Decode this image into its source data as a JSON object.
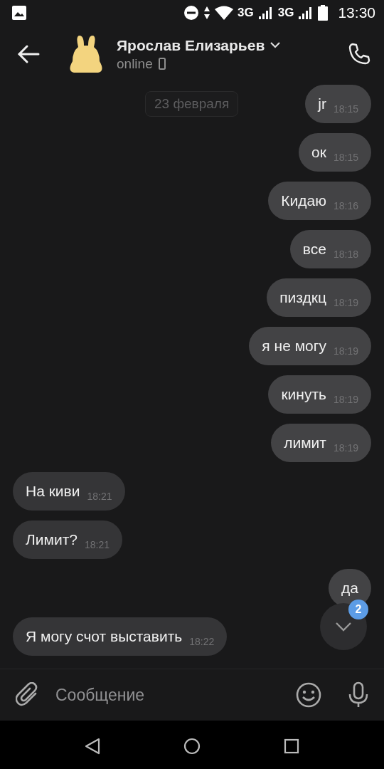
{
  "status_bar": {
    "network_labels": [
      "3G",
      "3G"
    ],
    "time": "13:30"
  },
  "header": {
    "name": "Ярослав Елизарьев",
    "status": "online"
  },
  "date_chip": "23 февраля",
  "messages": [
    {
      "text": "jr",
      "time": "18:15",
      "outgoing": true
    },
    {
      "text": "ок",
      "time": "18:15",
      "outgoing": true
    },
    {
      "text": "Кидаю",
      "time": "18:16",
      "outgoing": true
    },
    {
      "text": "все",
      "time": "18:18",
      "outgoing": true
    },
    {
      "text": "пиздкц",
      "time": "18:19",
      "outgoing": true
    },
    {
      "text": "я не могу",
      "time": "18:19",
      "outgoing": true
    },
    {
      "text": "кинуть",
      "time": "18:19",
      "outgoing": true
    },
    {
      "text": "лимит",
      "time": "18:19",
      "outgoing": true
    },
    {
      "text": "На киви",
      "time": "18:21",
      "outgoing": false
    },
    {
      "text": "Лимит?",
      "time": "18:21",
      "outgoing": false
    },
    {
      "text": "да",
      "outgoing": true
    },
    {
      "text": "Я могу счот выставить",
      "time": "18:22",
      "outgoing": false
    }
  ],
  "scroll_button": {
    "badge": "2"
  },
  "composer": {
    "placeholder": "Сообщение"
  }
}
